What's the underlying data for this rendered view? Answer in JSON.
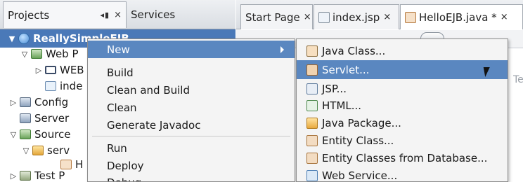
{
  "left_panel": {
    "tabs": [
      {
        "label": "Projects",
        "controls": "◂▮",
        "close": "×"
      },
      {
        "label": "Services"
      }
    ],
    "tree": [
      {
        "label": "ReallySimpleEJB",
        "selected": true,
        "icon": "globe-icon"
      },
      {
        "label": "Web P",
        "icon": "web-folder-icon"
      },
      {
        "label": "WEB",
        "icon": "folder-icon"
      },
      {
        "label": "inde",
        "icon": "jsp-file-icon"
      },
      {
        "label": "Config",
        "icon": "config-icon"
      },
      {
        "label": "Server",
        "icon": "server-icon"
      },
      {
        "label": "Source",
        "icon": "source-icon"
      },
      {
        "label": "serv",
        "icon": "package-icon"
      },
      {
        "label": "H",
        "icon": "java-file-icon"
      },
      {
        "label": "Test P",
        "icon": "test-icon"
      }
    ]
  },
  "editor": {
    "tabs": [
      {
        "label": "Start Page",
        "close": "×"
      },
      {
        "label": "index.jsp",
        "close": "×"
      },
      {
        "label": "HelloEJB.java *",
        "close": "×"
      }
    ],
    "ghost_text": "Te"
  },
  "context_menu": {
    "items": [
      {
        "label": "New",
        "active": true,
        "has_submenu": true
      },
      {
        "label": "Build"
      },
      {
        "label": "Clean and Build"
      },
      {
        "label": "Clean"
      },
      {
        "label": "Generate Javadoc"
      },
      {
        "label": "Run"
      },
      {
        "label": "Deploy"
      },
      {
        "label": "Debug"
      }
    ]
  },
  "submenu": {
    "items": [
      {
        "label": "Java Class...",
        "icon": "java-class-icon"
      },
      {
        "label": "Servlet...",
        "icon": "servlet-icon",
        "active": true
      },
      {
        "label": "JSP...",
        "icon": "jsp-icon"
      },
      {
        "label": "HTML...",
        "icon": "html-icon"
      },
      {
        "label": "Java Package...",
        "icon": "java-package-icon"
      },
      {
        "label": "Entity Class...",
        "icon": "entity-class-icon"
      },
      {
        "label": "Entity Classes from Database...",
        "icon": "entity-db-icon"
      },
      {
        "label": "Web Service...",
        "icon": "web-service-icon"
      }
    ]
  },
  "colors": {
    "selection": "#5a87c0",
    "tree_selection": "#4a79b8",
    "menu_bg": "#f4f4f4"
  }
}
